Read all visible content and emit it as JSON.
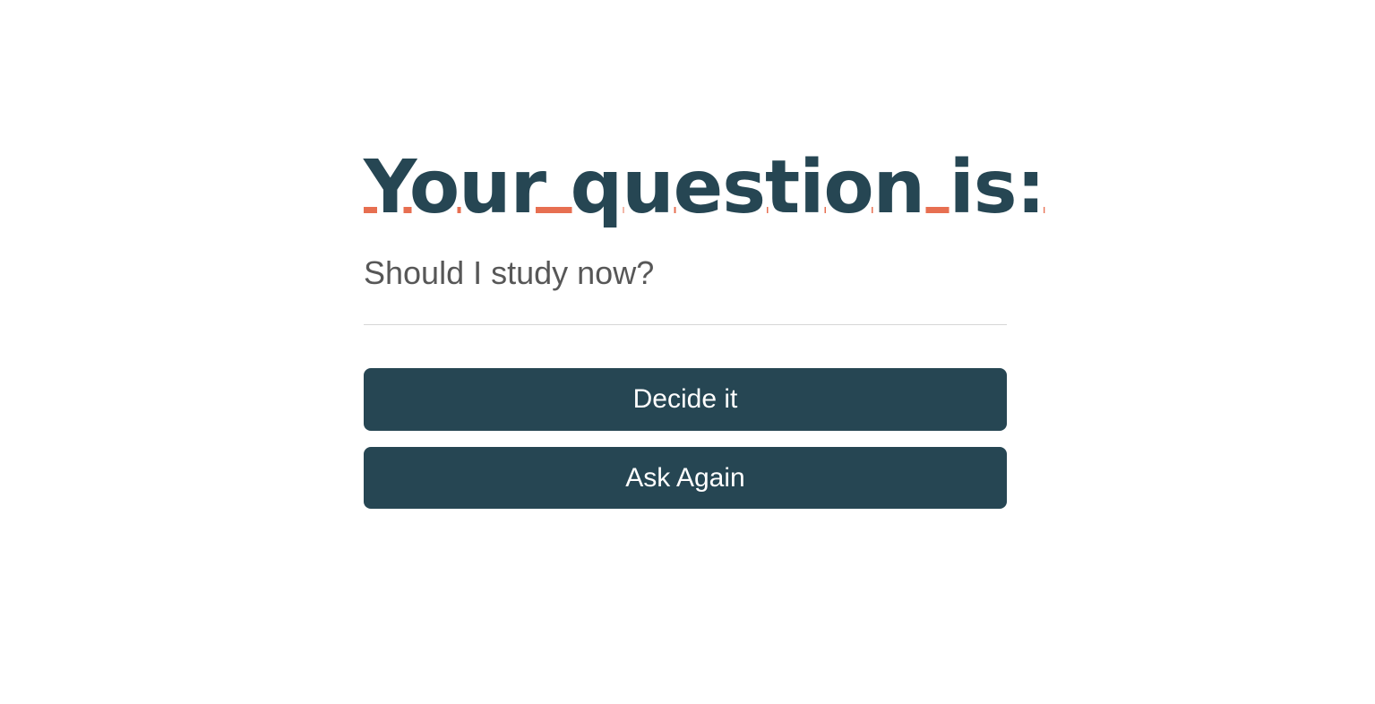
{
  "heading": {
    "title": "Your question is:"
  },
  "question": {
    "text": "Should I study now?"
  },
  "buttons": {
    "decide_label": "Decide it",
    "ask_again_label": "Ask Again"
  },
  "colors": {
    "primary": "#264653",
    "accent_underline": "#e76f51",
    "button_text": "#ffffff",
    "divider": "#d6d6d6"
  }
}
